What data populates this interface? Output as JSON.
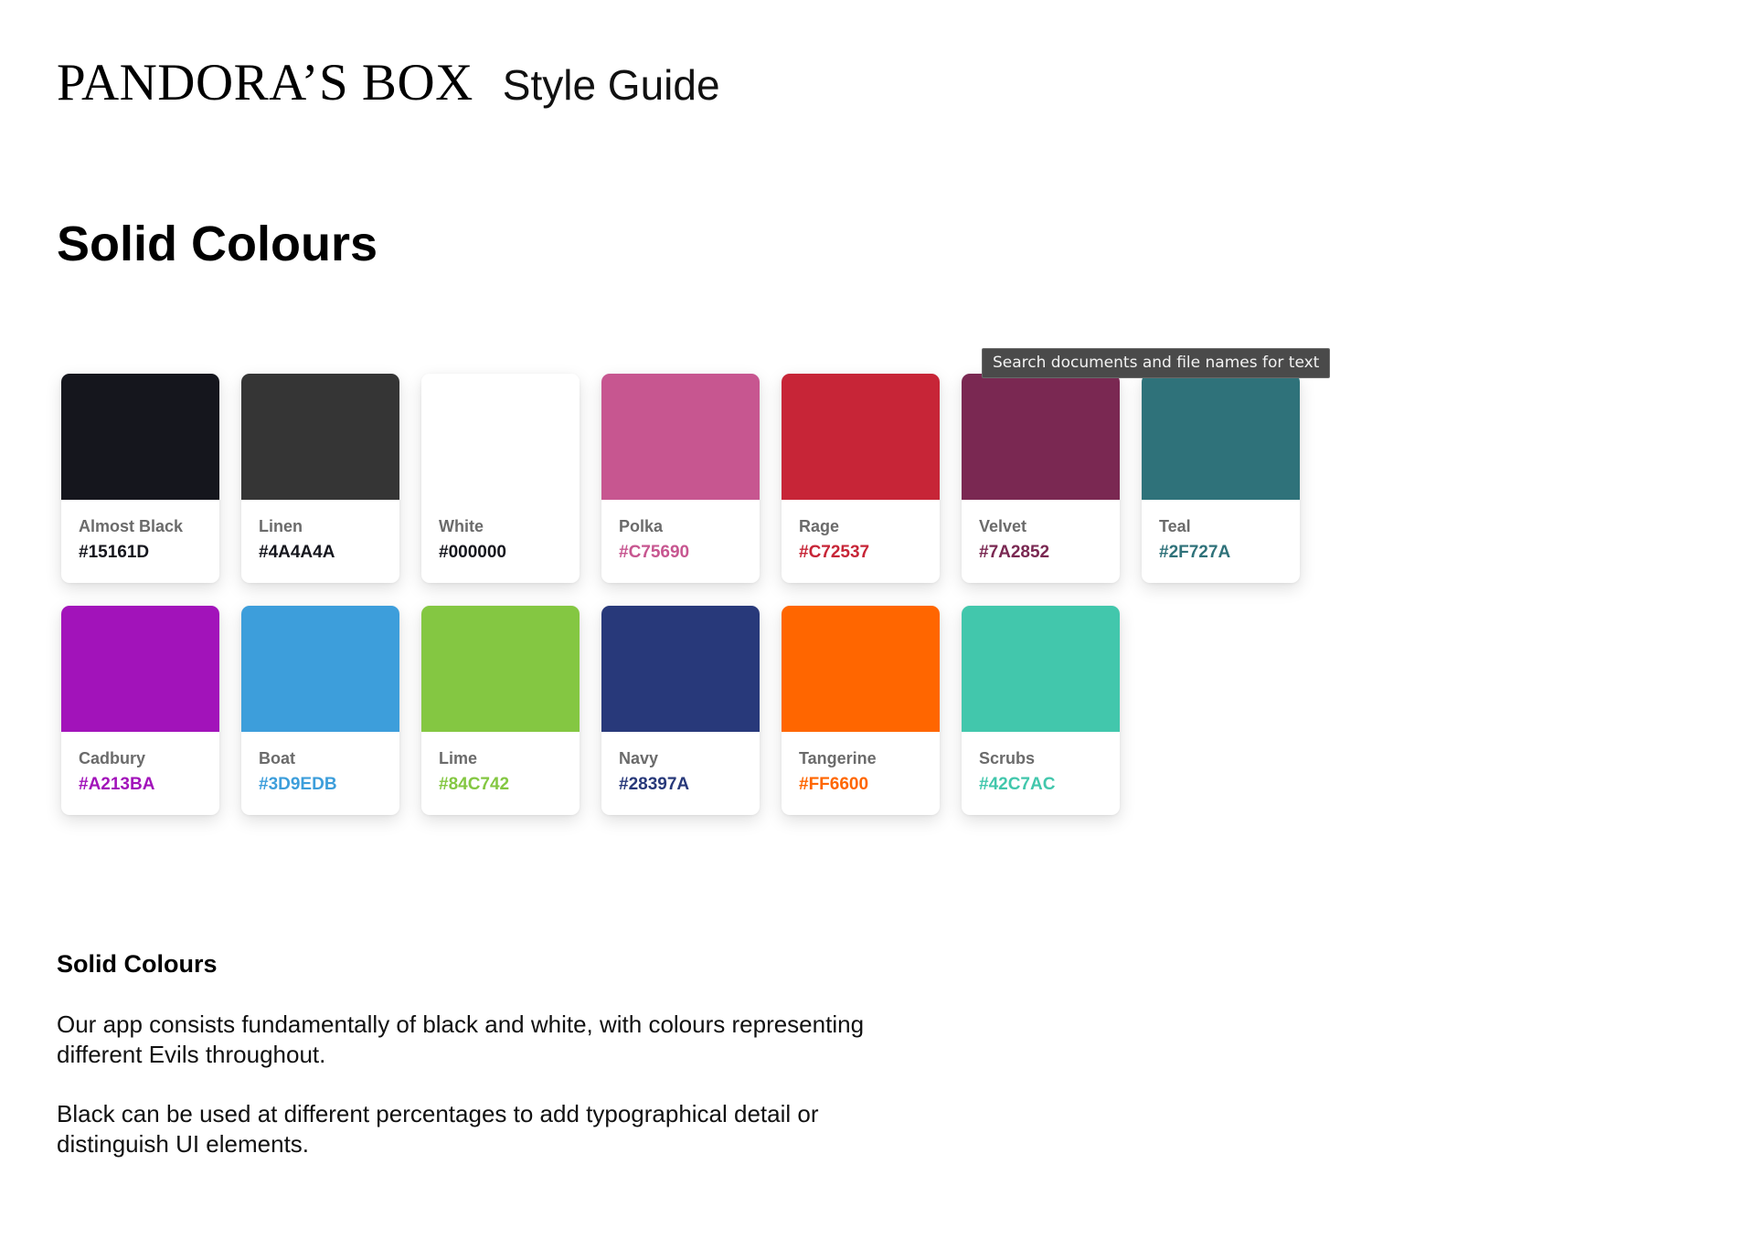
{
  "header": {
    "brand": "PANDORA’S BOX",
    "subtitle": "Style Guide"
  },
  "section_title": "Solid Colours",
  "tooltip": "Search documents and file names for text",
  "swatches_row1": [
    {
      "name": "Almost Black",
      "hex": "#15161D",
      "color": "#15161D",
      "text_color": "#15161D"
    },
    {
      "name": "Linen",
      "hex": "#4A4A4A",
      "color": "#353535",
      "text_color": "#15161D"
    },
    {
      "name": "White",
      "hex": "#000000",
      "color": "#FFFFFF",
      "text_color": "#15161D"
    },
    {
      "name": "Polka",
      "hex": "#C75690",
      "color": "#C75690",
      "text_color": "#C75690"
    },
    {
      "name": "Rage",
      "hex": "#C72537",
      "color": "#C72537",
      "text_color": "#C72537"
    },
    {
      "name": "Velvet",
      "hex": "#7A2852",
      "color": "#7A2852",
      "text_color": "#7A2852"
    },
    {
      "name": "Teal",
      "hex": "#2F727A",
      "color": "#2F727A",
      "text_color": "#2F727A"
    }
  ],
  "swatches_row2": [
    {
      "name": "Cadbury",
      "hex": "#A213BA",
      "color": "#A213BA",
      "text_color": "#A213BA"
    },
    {
      "name": "Boat",
      "hex": "#3D9EDB",
      "color": "#3D9EDB",
      "text_color": "#3D9EDB"
    },
    {
      "name": "Lime",
      "hex": "#84C742",
      "color": "#84C742",
      "text_color": "#84C742"
    },
    {
      "name": "Navy",
      "hex": "#28397A",
      "color": "#28397A",
      "text_color": "#28397A"
    },
    {
      "name": "Tangerine",
      "hex": "#FF6600",
      "color": "#FF6600",
      "text_color": "#FF6600"
    },
    {
      "name": "Scrubs",
      "hex": "#42C7AC",
      "color": "#42C7AC",
      "text_color": "#42C7AC"
    }
  ],
  "notes": {
    "title": "Solid Colours",
    "paragraph_1": "Our app consists fundamentally of black and white, with colours representing different Evils throughout.",
    "paragraph_2": "Black can be used at different percentages to add typographical detail or distinguish UI elements."
  }
}
